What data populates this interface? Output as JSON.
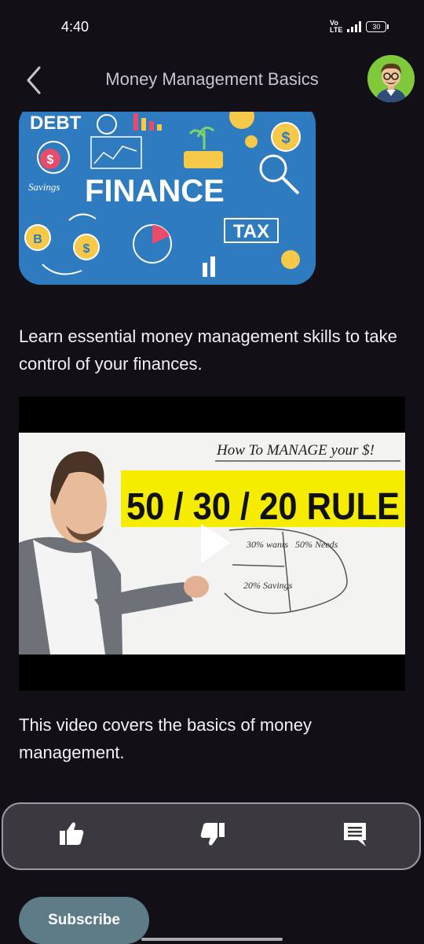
{
  "status": {
    "time": "4:40",
    "network": "Vo LTE 4G",
    "battery": "30"
  },
  "header": {
    "title": "Money Management Basics",
    "back_icon": "chevron-left-icon",
    "avatar_icon": "avatar-cartoon"
  },
  "hero_image": {
    "words": {
      "debt": "DEBT",
      "savings": "Savings",
      "finance": "FINANCE",
      "tax": "TAX"
    }
  },
  "intro_text": "Learn essential money management skills to take control of your finances.",
  "video": {
    "headline": "How To MANAGE your $!",
    "rule": "50 / 30 / 20 RULE",
    "pie_labels": {
      "wants": "30% wants",
      "needs": "50% Needs",
      "savings": "20% Savings"
    },
    "play_icon": "play-icon"
  },
  "video_caption": "This video covers the basics of money management.",
  "actions": {
    "like_icon": "thumbs-up-icon",
    "dislike_icon": "thumbs-down-icon",
    "comment_icon": "comment-icon"
  },
  "subscribe_label": "Subscribe",
  "colors": {
    "background": "#121016",
    "action_bar": "#3b393f",
    "subscribe": "#5d7c88",
    "rule_highlight": "#f5ec00"
  }
}
